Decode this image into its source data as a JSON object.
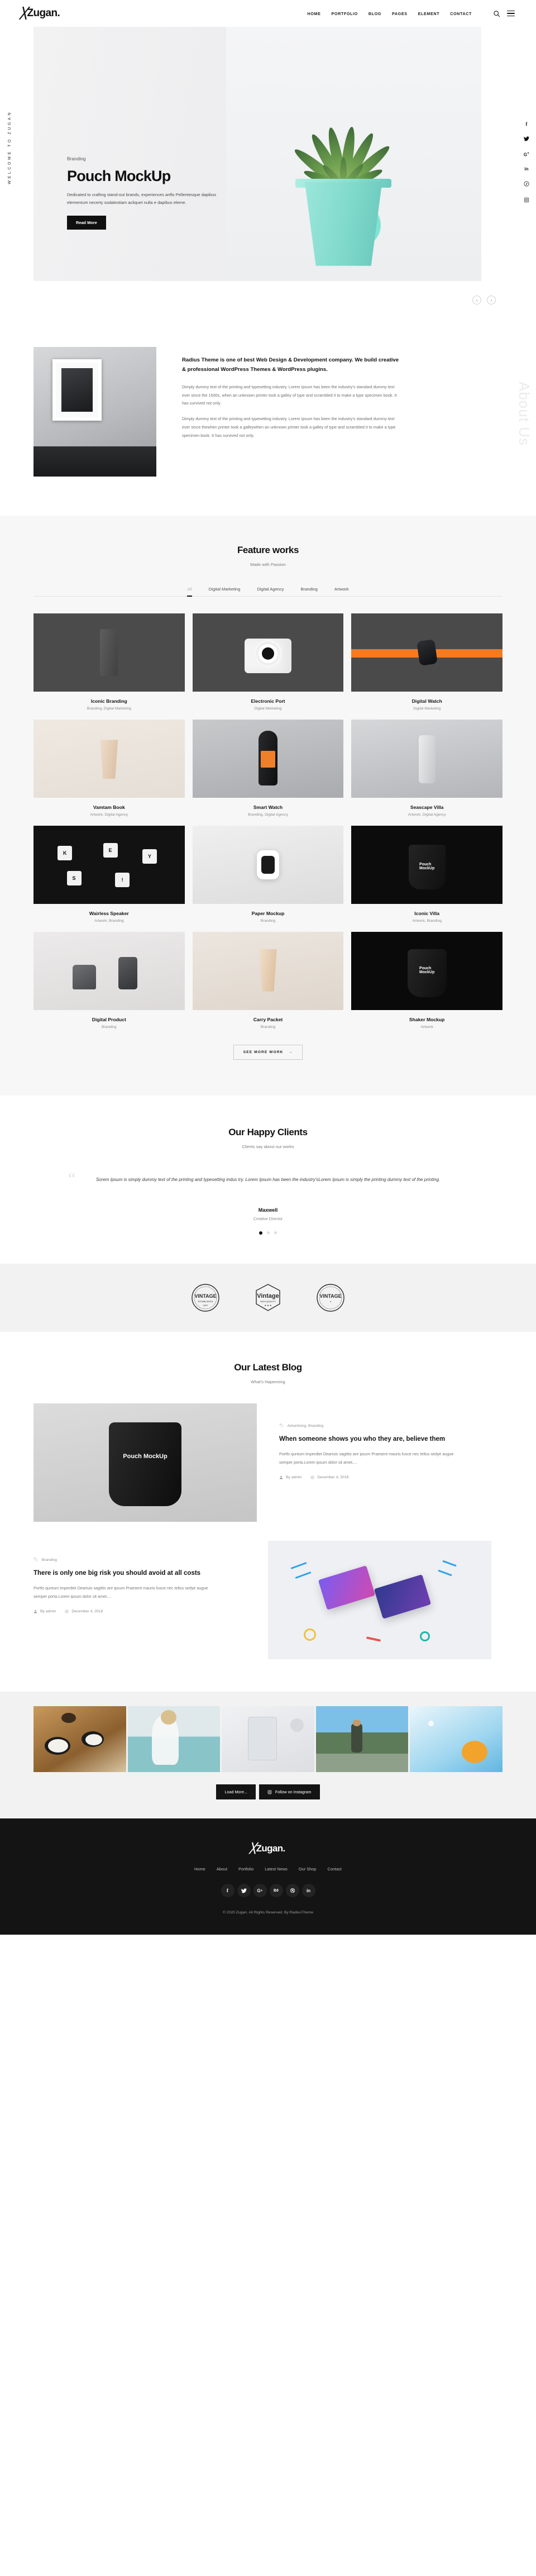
{
  "header": {
    "logo": "Zugan.",
    "nav": [
      "HOME",
      "PORTFOLIO",
      "BLOG",
      "PAGES",
      "ELEMENT",
      "CONTACT"
    ],
    "search_icon": "search-icon",
    "menu_icon": "hamburger-icon"
  },
  "hero": {
    "side_label": "WELCOME TO ZUGAN",
    "category": "Branding",
    "title": "Pouch MockUp",
    "description": "Dedicated to crafting stand-out brands, experiences anflo Pellentesque dapibus elementum necerty sodalestiam acliquet nulla e dapibus eleme.",
    "button": "Read More",
    "social": [
      "f",
      "twitter",
      "G+",
      "in",
      "P",
      "ig"
    ],
    "prev": "‹",
    "next": "›"
  },
  "about": {
    "watermark": "About Us",
    "lead": "Radius Theme is one of best Web Design & Development company. We build creative & professional WordPress Themes & WordPress plugins.",
    "paragraph1": "Dimply dummy text of the printing and typesetting industry. Lorem Ipsum has been the industry's standard dummy text ever since the 1500s, when an unknown printer took a galley of type and scrambled it to make a type specimen book. It has survived not only.",
    "paragraph2": "Dimply dummy text of the printing and typesetting industry. Lorem Ipsum has been the industry's standard dummy text ever since thewhen printer took a galleywhen an unknown printer took a galley of type and scrambled it to make a type specimen book. It has survived not only."
  },
  "works": {
    "title": "Feature works",
    "subtitle": "Made with Passion",
    "filters": [
      "All",
      "Digital Marketing",
      "Digital Agency",
      "Branding",
      "Artwork"
    ],
    "active_filter": "All",
    "items": [
      {
        "title": "Iconic Branding",
        "cats": "Branding, Digital Marketing",
        "thumb": "t-bottle"
      },
      {
        "title": "Electronic Port",
        "cats": "Digital Marketing",
        "thumb": "t-cam"
      },
      {
        "title": "Digital Watch",
        "cats": "Digital Marketing",
        "thumb": "t-watch"
      },
      {
        "title": "Vamtam Book",
        "cats": "Artwork, Digital Agency",
        "thumb": "t-cup"
      },
      {
        "title": "Smart Watch",
        "cats": "Branding, Digital Agency",
        "thumb": "t-bottle2"
      },
      {
        "title": "Seascape Villa",
        "cats": "Artwork, Digital Agency",
        "thumb": "t-spray"
      },
      {
        "title": "Wairless Speaker",
        "cats": "Artwork, Branding",
        "thumb": "t-keys"
      },
      {
        "title": "Paper Mockup",
        "cats": "Branding",
        "thumb": "t-pwatch"
      },
      {
        "title": "Iconic Villa",
        "cats": "Artwork, Branding",
        "thumb": "t-pouch"
      },
      {
        "title": "Digital Product",
        "cats": "Branding",
        "thumb": "t-prod"
      },
      {
        "title": "Carry Packet",
        "cats": "Branding",
        "thumb": "t-carry"
      },
      {
        "title": "Shaker Mockup",
        "cats": "Artwork",
        "thumb": "t-shaker"
      }
    ],
    "see_more": "SEE MORE WORK"
  },
  "clients": {
    "title": "Our Happy Clients",
    "subtitle": "Clients say about our works",
    "quote": "Sorem Ipsum is simply dummy text of the printing and typesetting indus try. Lorem Ipsum has been the industry'sLorem Ipsum is simply the printing dummy text of the printing.",
    "author": "Maxwell",
    "role": "Creative Director",
    "dot_count": 3,
    "active_dot": 0
  },
  "logos": [
    {
      "name": "VINTAGE",
      "line2": "ESTABLISHED",
      "line3": "1997"
    },
    {
      "name": "Vintage",
      "line2": "HIGH QUALITY",
      "line3": "★ ★ ★"
    },
    {
      "name": "VINTAGE",
      "line2": "h",
      "line3": ""
    }
  ],
  "blog": {
    "title": "Our Latest Blog",
    "subtitle": "What's Hapenning",
    "posts": [
      {
        "tags": "Advertising, Branding",
        "title": "When someone shows you who they are, believe them",
        "excerpt": "Portfo quntum imperdiet Deartuis sagittis are ipsum Praesent mauris fusce nec tellus sedye augue semper porta.Lorem ipsum dolor sit amet,…",
        "author": "By admin",
        "date": "December 4, 2018",
        "image_caption": "Pouch MockUp"
      },
      {
        "tags": "Branding",
        "title": "There is only one big risk you should avoid at all costs",
        "excerpt": "Portfo quntum imperdiet Deartuis sagittis are ipsum Praesent mauris fusce nec tellus sedye augue semper porta.Lorem ipsum dolor sit amet,…",
        "author": "By admin",
        "date": "December 4, 2018",
        "image_caption": ""
      }
    ]
  },
  "instagram": {
    "load_more": "Load More...",
    "follow": "Follow on Instagram",
    "tile_count": 5
  },
  "footer": {
    "logo": "Zugan.",
    "nav": [
      "Home",
      "About",
      "Portfolio",
      "Latest News",
      "Our Shop",
      "Contact"
    ],
    "social": [
      "f",
      "twitter",
      "G+",
      "Be",
      "dribbble",
      "in"
    ],
    "copyright": "© 2020 Zugan. All Rights Reserved. By RadiusTheme"
  },
  "colors": {
    "accent_orange": "#f47b20",
    "dark": "#141414",
    "mint": "#7fd9cb",
    "section_bg": "#f7f7f7"
  }
}
